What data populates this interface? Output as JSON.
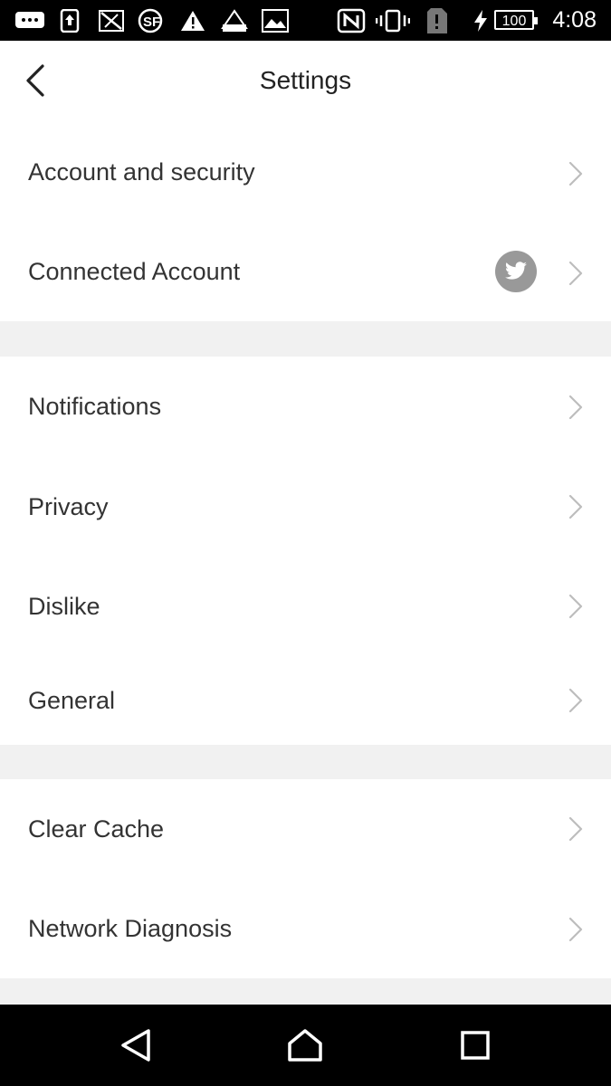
{
  "status_bar": {
    "time": "4:08",
    "battery": "100",
    "icons": [
      "message-icon",
      "upload-icon",
      "no-signal-icon",
      "sf-icon",
      "warning-icon",
      "photo-icon",
      "image-icon",
      "nfc-icon",
      "vibrate-icon",
      "sim-icon",
      "charging-icon"
    ]
  },
  "header": {
    "title": "Settings"
  },
  "sections": [
    {
      "items": [
        {
          "label": "Account and security"
        },
        {
          "label": "Connected Account",
          "badge": "twitter-icon"
        }
      ]
    },
    {
      "items": [
        {
          "label": "Notifications"
        },
        {
          "label": "Privacy"
        },
        {
          "label": "Dislike"
        },
        {
          "label": "General"
        }
      ]
    },
    {
      "items": [
        {
          "label": "Clear Cache"
        },
        {
          "label": "Network Diagnosis"
        }
      ]
    }
  ],
  "colors": {
    "section_gap": "#f1f1f1",
    "chevron": "#bdbdbd",
    "badge": "#999999"
  },
  "nav_bar": {
    "buttons": [
      "back-icon",
      "home-icon",
      "recents-icon"
    ]
  }
}
